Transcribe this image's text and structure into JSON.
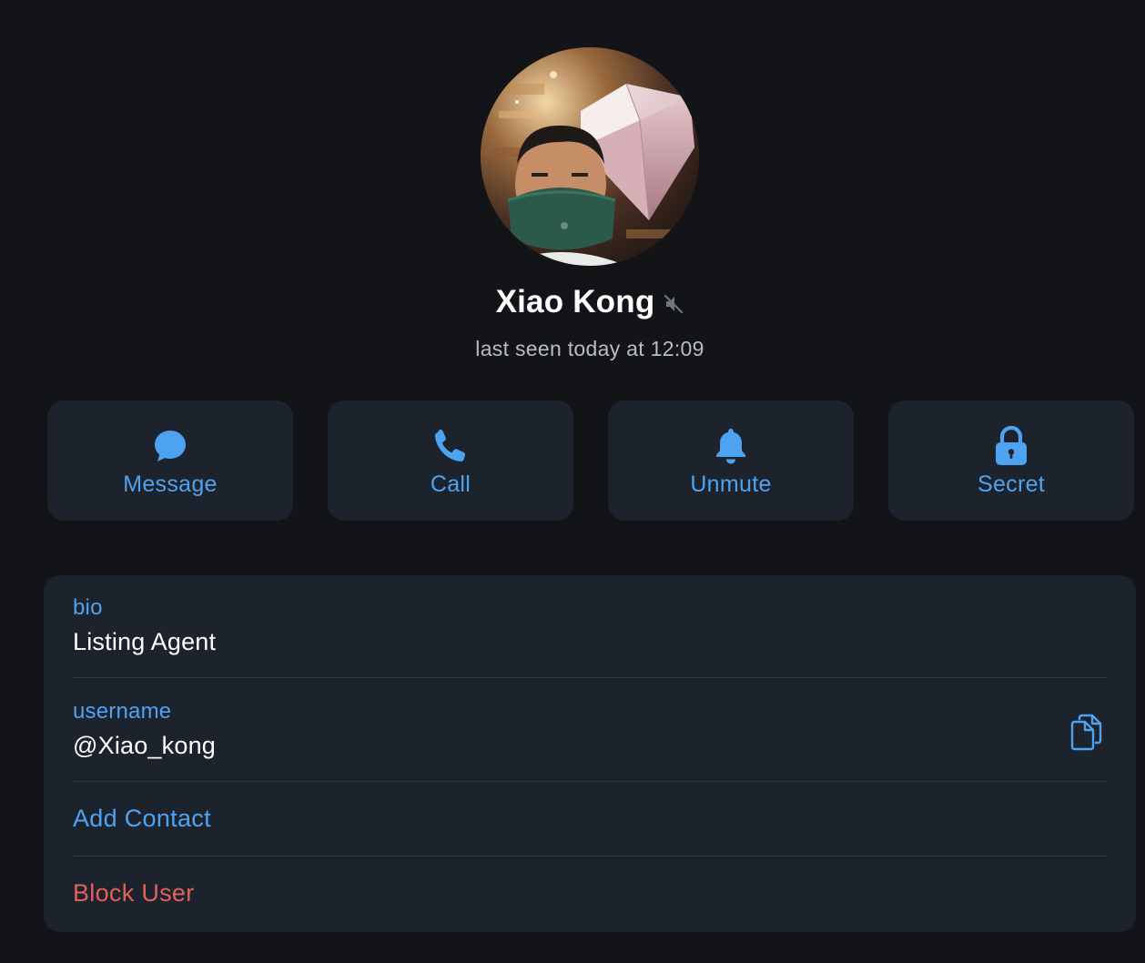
{
  "profile": {
    "name": "Xiao Kong",
    "status": "last seen today at 12:09",
    "muted_icon": "speaker-muted-icon",
    "avatar_icon": "profile-photo"
  },
  "actions": [
    {
      "label": "Message",
      "icon": "chat-bubble-icon"
    },
    {
      "label": "Call",
      "icon": "phone-icon"
    },
    {
      "label": "Unmute",
      "icon": "bell-icon"
    },
    {
      "label": "Secret",
      "icon": "lock-icon"
    }
  ],
  "info": {
    "bio_label": "bio",
    "bio_value": "Listing Agent",
    "username_label": "username",
    "username_value": "@Xiao_kong",
    "copy_icon": "copy-icon",
    "add_contact": "Add Contact",
    "block_user": "Block User"
  },
  "colors": {
    "background": "#131417",
    "card": "#1c232d",
    "accent": "#4ea3f1",
    "danger": "#e2615c",
    "secondary_text": "#b8bcc3"
  }
}
